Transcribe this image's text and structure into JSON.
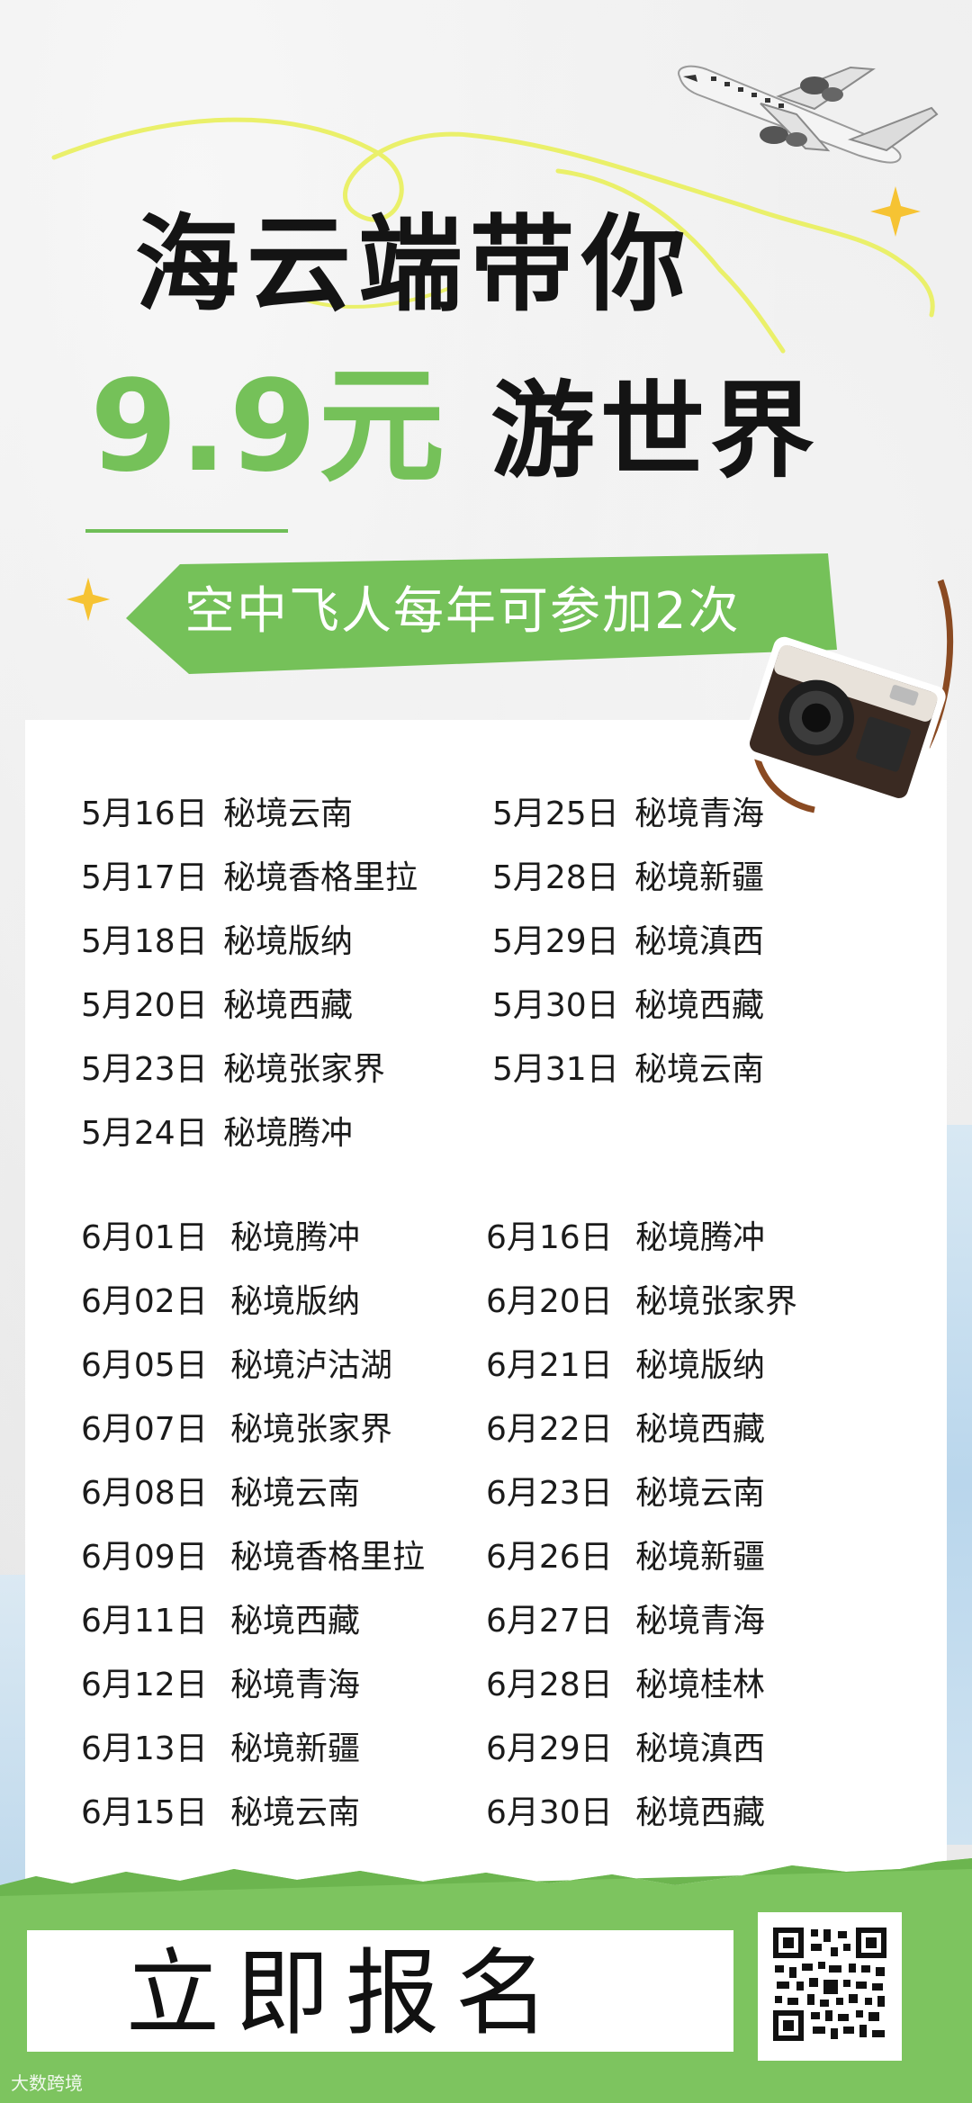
{
  "poster": {
    "title_line1": "海云端带你",
    "price": "9.9元",
    "title_line2": "游世界",
    "banner": "空中飞人每年可参加2次",
    "signup": "立即报名",
    "watermark": "大数跨境"
  },
  "colors": {
    "accent_green": "#75c159",
    "title_black": "#141414",
    "star_yellow": "#f6c333"
  },
  "icons": [
    "airplane-icon",
    "camera-icon",
    "star-icon",
    "qr-code-icon"
  ],
  "may_left": [
    {
      "date": "5月16日",
      "place": "秘境云南"
    },
    {
      "date": "5月17日",
      "place": "秘境香格里拉"
    },
    {
      "date": "5月18日",
      "place": "秘境版纳"
    },
    {
      "date": "5月20日",
      "place": "秘境西藏"
    },
    {
      "date": "5月23日",
      "place": "秘境张家界"
    },
    {
      "date": "5月24日",
      "place": "秘境腾冲"
    }
  ],
  "may_right": [
    {
      "date": "5月25日",
      "place": "秘境青海"
    },
    {
      "date": "5月28日",
      "place": "秘境新疆"
    },
    {
      "date": "5月29日",
      "place": "秘境滇西"
    },
    {
      "date": "5月30日",
      "place": "秘境西藏"
    },
    {
      "date": "5月31日",
      "place": "秘境云南"
    }
  ],
  "june_left": [
    {
      "date": "6月01日",
      "place": "秘境腾冲"
    },
    {
      "date": "6月02日",
      "place": "秘境版纳"
    },
    {
      "date": "6月05日",
      "place": "秘境泸沽湖"
    },
    {
      "date": "6月07日",
      "place": "秘境张家界"
    },
    {
      "date": "6月08日",
      "place": "秘境云南"
    },
    {
      "date": "6月09日",
      "place": "秘境香格里拉"
    },
    {
      "date": "6月11日",
      "place": "秘境西藏"
    },
    {
      "date": "6月12日",
      "place": "秘境青海"
    },
    {
      "date": "6月13日",
      "place": "秘境新疆"
    },
    {
      "date": "6月15日",
      "place": "秘境云南"
    }
  ],
  "june_right": [
    {
      "date": "6月16日",
      "place": "秘境腾冲"
    },
    {
      "date": "6月20日",
      "place": "秘境张家界"
    },
    {
      "date": "6月21日",
      "place": "秘境版纳"
    },
    {
      "date": "6月22日",
      "place": "秘境西藏"
    },
    {
      "date": "6月23日",
      "place": "秘境云南"
    },
    {
      "date": "6月26日",
      "place": "秘境新疆"
    },
    {
      "date": "6月27日",
      "place": "秘境青海"
    },
    {
      "date": "6月28日",
      "place": "秘境桂林"
    },
    {
      "date": "6月29日",
      "place": "秘境滇西"
    },
    {
      "date": "6月30日",
      "place": "秘境西藏"
    }
  ]
}
